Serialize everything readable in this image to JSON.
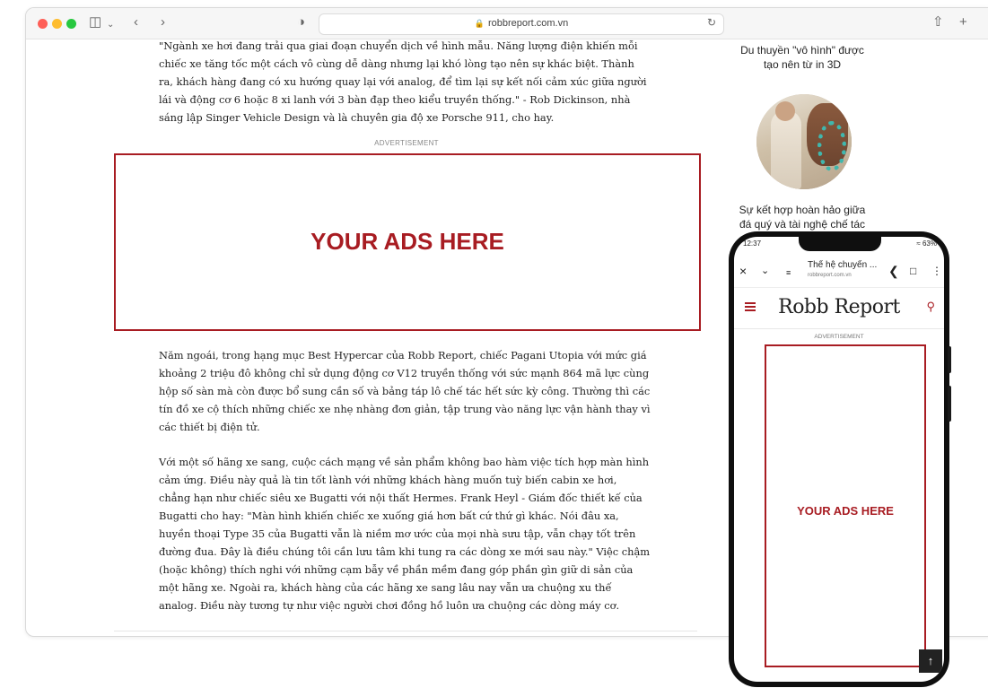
{
  "browser": {
    "url": "robbreport.com.vn",
    "icons": [
      "sidebar-icon",
      "back-icon",
      "forward-icon",
      "shield-icon",
      "lock-icon",
      "reload-icon",
      "share-icon",
      "new-tab-icon"
    ]
  },
  "article": {
    "p1": "\"Ngành xe hơi đang trải qua giai đoạn chuyển dịch về hình mẫu. Năng lượng điện khiến mỗi chiếc xe tăng tốc một cách vô cùng dễ dàng nhưng lại khó lòng tạo nên sự khác biệt. Thành ra, khách hàng đang có xu hướng quay lại với analog, để tìm lại sự kết nối cảm xúc giữa người lái và động cơ 6 hoặc 8 xi lanh với 3 bàn đạp theo kiểu truyền thống.\" - Rob Dickinson, nhà sáng lập Singer Vehicle Design và là chuyên gia độ xe Porsche 911, cho hay.",
    "ad_label": "ADVERTISEMENT",
    "ad_text": "YOUR ADS HERE",
    "p2": "Năm ngoái, trong hạng mục Best Hypercar của Robb Report, chiếc Pagani Utopia với mức giá khoảng 2 triệu đô không chỉ sử dụng động cơ V12 truyền thống với sức mạnh 864 mã lực cùng hộp số sàn mà còn được bổ sung cần số và bảng táp lô chế tác hết sức kỳ công. Thường thì các tín đồ xe cộ thích những chiếc xe nhẹ nhàng đơn giản, tập trung vào năng lực vận hành thay vì các thiết bị điện tử.",
    "p3": "Với một số hãng xe sang, cuộc cách mạng về sản phẩm không bao hàm việc tích hợp màn hình cảm ứng. Điều này quả là tin tốt lành với những khách hàng muốn tuỳ biến cabin xe hơi, chẳng hạn như chiếc siêu xe Bugatti với nội thất Hermes. Frank Heyl - Giám đốc thiết kế của Bugatti cho hay: \"Màn hình khiến chiếc xe xuống giá hơn bất cứ thứ gì khác. Nói đâu xa, huyền thoại Type 35 của Bugatti vẫn là niềm mơ ước của mọi nhà sưu tập, vẫn chạy tốt trên đường đua. Đây là điều chúng tôi cần lưu tâm khi tung ra các dòng xe mới sau này.\" Việc chậm (hoặc không) thích nghi với những cạm bẫy về phần mềm đang góp phần gìn giữ di sản của một hãng xe. Ngoài ra, khách hàng của các hãng xe sang lâu nay vẫn ưa chuộng xu thế analog. Điều này tương tự như việc người chơi đồng hồ luôn ưa chuộng các dòng máy cơ."
  },
  "sidebar": {
    "caption1_line1": "Du thuyền \"vô hình\" được",
    "caption1_line2": "tạo nên từ in 3D",
    "caption2_line1": "Sự kết hợp hoàn hảo giữa",
    "caption2_line2": "đá quý và tài nghệ chế tác"
  },
  "phone": {
    "time": "12:37",
    "battery": "63%",
    "tab_title": "Thế hệ chuyển ...",
    "tab_url": "robbreport.com.vn",
    "logo": "Robb Report",
    "ad_label": "ADVERTISEMENT",
    "ad_text": "YOUR ADS HERE",
    "scroll_top": "↑"
  }
}
